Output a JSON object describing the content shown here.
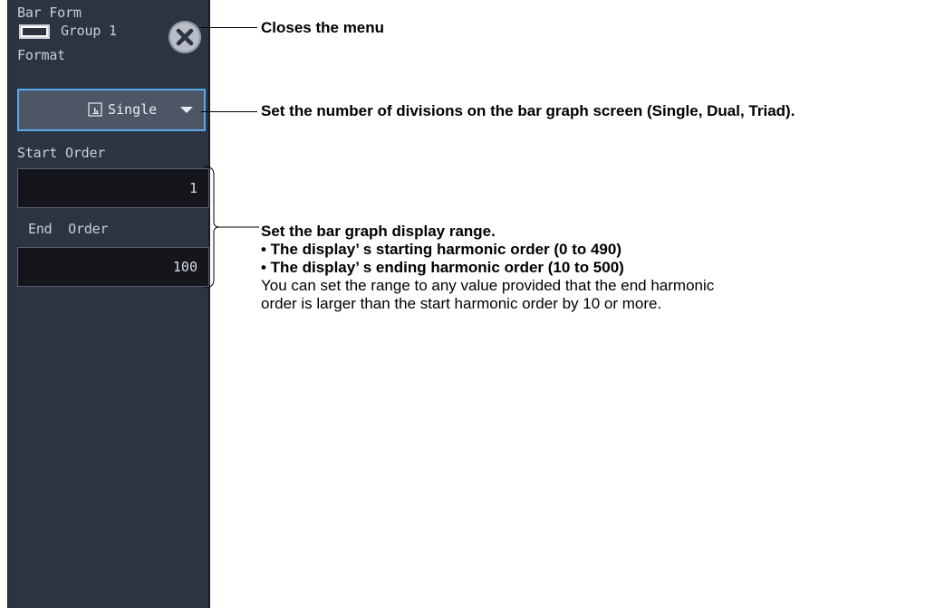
{
  "panel": {
    "title": "Bar Form",
    "group_label": "Group 1",
    "format_label": "Format",
    "format_select": {
      "value": "Single",
      "icon": "single-division-icon"
    },
    "close_icon": "close-icon",
    "start_order": {
      "label": "Start Order",
      "value": "1"
    },
    "end_order": {
      "label": "End  Order",
      "value": "100"
    }
  },
  "callouts": {
    "close": "Closes the menu",
    "format": "Set the number of divisions on the bar graph screen (Single, Dual, Triad).",
    "range_title": "Set the bar graph display range.",
    "range_start": "• The display’ s starting harmonic order (0 to 490)",
    "range_end": "• The display’ s ending harmonic order (10 to 500)",
    "range_note_1": "You can set the range to any value provided that the end harmonic",
    "range_note_2": "order is larger than the start harmonic order by 10 or more."
  },
  "colors": {
    "panel_bg": "#2d3340",
    "select_border": "#55aaee",
    "value_bg": "#14161b",
    "text": "#c9ced8"
  }
}
